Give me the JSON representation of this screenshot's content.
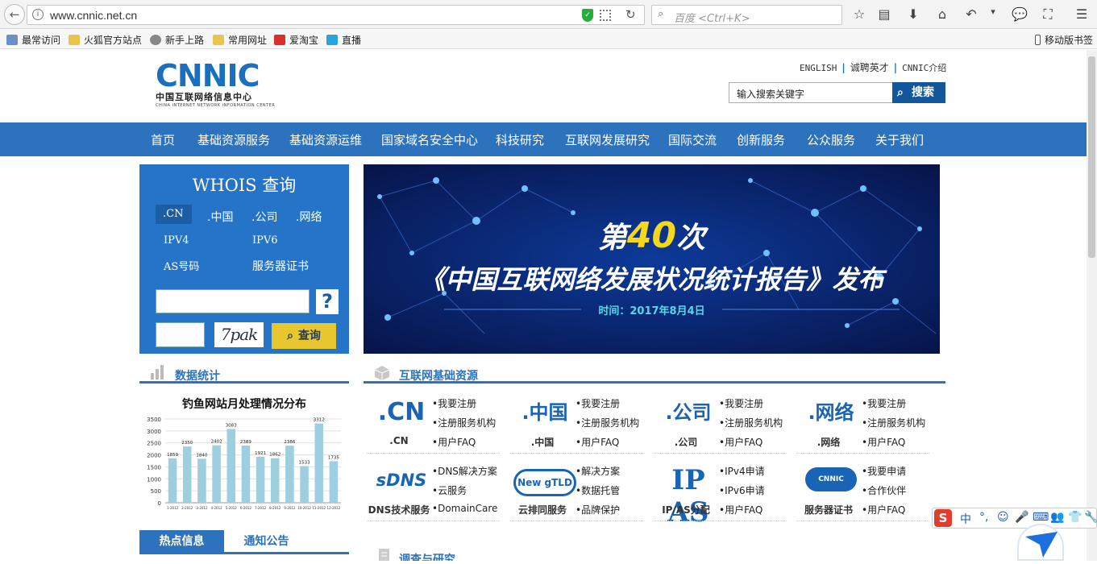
{
  "browser": {
    "url": "www.cnnic.net.cn",
    "search_placeholder": "百度 <Ctrl+K>",
    "bookmarks": [
      "最常访问",
      "火狐官方站点",
      "新手上路",
      "常用网址",
      "爱淘宝",
      "直播"
    ],
    "mobile_bookmarks": "移动版书签"
  },
  "header": {
    "logo_text": "CNNIC",
    "logo_cn": "中国互联网络信息中心",
    "logo_en": "CHINA INTERNET NETWORK INFORMATION CENTER",
    "top_links": [
      "ENGLISH",
      "诚聘英才",
      "CNNIC介绍"
    ],
    "search_value": "输入搜索关键字",
    "search_button": "搜索"
  },
  "nav": [
    "首页",
    "基础资源服务",
    "基础资源运维",
    "国家域名安全中心",
    "科技研究",
    "互联网发展研究",
    "国际交流",
    "创新服务",
    "公众服务",
    "关于我们"
  ],
  "whois": {
    "title": "WHOIS 查询",
    "tabs": [
      ".CN",
      ".中国",
      ".公司",
      ".网络"
    ],
    "tabs2": [
      "IPV4",
      "IPV6",
      "AS号码",
      "服务器证书"
    ],
    "help": "?",
    "captcha": "7pak",
    "query_button": "查询"
  },
  "banner": {
    "line1_prefix": "第",
    "line1_num": "40",
    "line1_suffix": "次",
    "line2": "《中国互联网络发展状况统计报告》发布",
    "date": "时间：2017年8月4日"
  },
  "stats": {
    "heading": "数据统计"
  },
  "resources": {
    "heading": "互联网基础资源",
    "items": [
      {
        "logo": ".CN",
        "caption": ".CN",
        "links": [
          "•我要注册",
          "•注册服务机构",
          "•用户FAQ"
        ]
      },
      {
        "logo": ".中国",
        "caption": ".中国",
        "links": [
          "•我要注册",
          "•注册服务机构",
          "•用户FAQ"
        ]
      },
      {
        "logo": ".公司",
        "caption": ".公司",
        "links": [
          "•我要注册",
          "•注册服务机构",
          "•用户FAQ"
        ]
      },
      {
        "logo": ".网络",
        "caption": ".网络",
        "links": [
          "•我要注册",
          "•注册服务机构",
          "•用户FAQ"
        ]
      },
      {
        "logo": "sDNS",
        "caption": "DNS技术服务",
        "links": [
          "•DNS解决方案",
          "•云服务",
          "•DomainCare"
        ]
      },
      {
        "logo": "New gTLD",
        "caption": "云排同服务",
        "links": [
          "•解决方案",
          "•数据托管",
          "•品牌保护"
        ]
      },
      {
        "logo": "IP AS",
        "caption": "IP/AS分配",
        "links": [
          "•IPv4申请",
          "•IPv6申请",
          "•用户FAQ"
        ]
      },
      {
        "logo": "CNNIC SECURED",
        "caption": "服务器证书",
        "links": [
          "•我要申请",
          "•合作伙伴",
          "•用户FAQ"
        ]
      }
    ]
  },
  "tabs_bottom": {
    "hot": "热点信息",
    "notice": "通知公告"
  },
  "survey": {
    "heading": "调查与研究"
  },
  "ime": {
    "logo": "S",
    "items": [
      "中",
      "°,",
      "☺",
      "🎤",
      "⌨",
      "👥",
      "👕",
      "🔧"
    ]
  },
  "chart_data": {
    "type": "bar",
    "title": "钓鱼网站月处理情况分布",
    "categories": [
      "1-2012",
      "2-2012",
      "3-2012",
      "4-2012",
      "5-2012",
      "6-2012",
      "7-2012",
      "8-2012",
      "9-2012",
      "10-2012",
      "11-2012",
      "12-2012"
    ],
    "values": [
      1859,
      2350,
      1840,
      2402,
      3083,
      2389,
      1921,
      1862,
      2386,
      1533,
      3312,
      1735
    ],
    "ylim": [
      0,
      3500
    ],
    "yticks": [
      0,
      500,
      1000,
      1500,
      2000,
      2500,
      3000,
      3500
    ],
    "grid": true,
    "bar_color": "#9ecfe0"
  }
}
